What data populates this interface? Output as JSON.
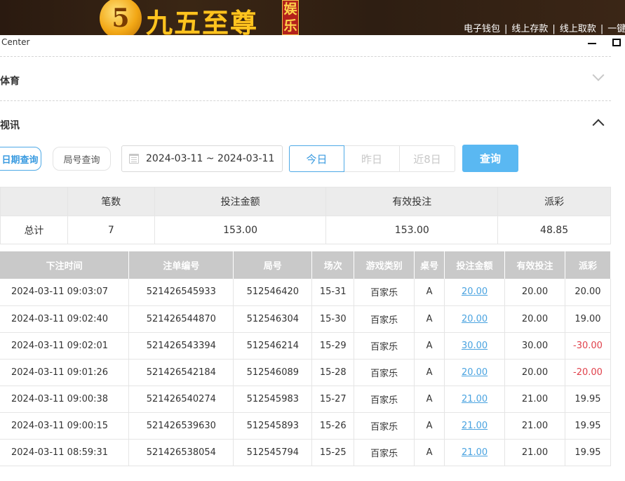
{
  "banner": {
    "logo_glyph": "5",
    "logo_text": "九五至尊",
    "logo_seal": "娱乐",
    "links": [
      "电子钱包",
      "线上存款",
      "线上取款",
      "一键"
    ]
  },
  "window": {
    "title": "Center"
  },
  "sections": {
    "sports": "体育",
    "live": "视讯"
  },
  "filters": {
    "date_query": "日期查询",
    "round_query": "局号查询",
    "date_range": "2024-03-11 ~ 2024-03-11",
    "today": "今日",
    "yesterday": "昨日",
    "last8": "近8日",
    "query": "查询"
  },
  "summary": {
    "headers": [
      "笔数",
      "投注金额",
      "有效投注",
      "派彩"
    ],
    "row_label": "总计",
    "values": [
      "7",
      "153.00",
      "153.00",
      "48.85"
    ]
  },
  "detail": {
    "headers": [
      "下注时间",
      "注单编号",
      "局号",
      "场次",
      "游戏类别",
      "桌号",
      "投注金额",
      "有效投注",
      "派彩"
    ],
    "rows": [
      {
        "time": "2024-03-11 09:03:07",
        "bet_id": "521426545933",
        "round": "512546420",
        "session": "15-31",
        "game": "百家乐",
        "table": "A",
        "amount": "20.00",
        "valid": "20.00",
        "payout": "20.00",
        "neg": false
      },
      {
        "time": "2024-03-11 09:02:40",
        "bet_id": "521426544870",
        "round": "512546304",
        "session": "15-30",
        "game": "百家乐",
        "table": "A",
        "amount": "20.00",
        "valid": "20.00",
        "payout": "19.00",
        "neg": false
      },
      {
        "time": "2024-03-11 09:02:01",
        "bet_id": "521426543394",
        "round": "512546214",
        "session": "15-29",
        "game": "百家乐",
        "table": "A",
        "amount": "30.00",
        "valid": "30.00",
        "payout": "-30.00",
        "neg": true
      },
      {
        "time": "2024-03-11 09:01:26",
        "bet_id": "521426542184",
        "round": "512546089",
        "session": "15-28",
        "game": "百家乐",
        "table": "A",
        "amount": "20.00",
        "valid": "20.00",
        "payout": "-20.00",
        "neg": true
      },
      {
        "time": "2024-03-11 09:00:38",
        "bet_id": "521426540274",
        "round": "512545983",
        "session": "15-27",
        "game": "百家乐",
        "table": "A",
        "amount": "21.00",
        "valid": "21.00",
        "payout": "19.95",
        "neg": false
      },
      {
        "time": "2024-03-11 09:00:15",
        "bet_id": "521426539630",
        "round": "512545893",
        "session": "15-26",
        "game": "百家乐",
        "table": "A",
        "amount": "21.00",
        "valid": "21.00",
        "payout": "19.95",
        "neg": false
      },
      {
        "time": "2024-03-11 08:59:31",
        "bet_id": "521426538054",
        "round": "512545794",
        "session": "15-25",
        "game": "百家乐",
        "table": "A",
        "amount": "21.00",
        "valid": "21.00",
        "payout": "19.95",
        "neg": false
      }
    ]
  },
  "colors": {
    "accent": "#4ea9e6",
    "query_btn": "#5ab8f2",
    "negative": "#e0414b",
    "banner": "#2e1e12",
    "logo_gold": "#ffc41f"
  }
}
